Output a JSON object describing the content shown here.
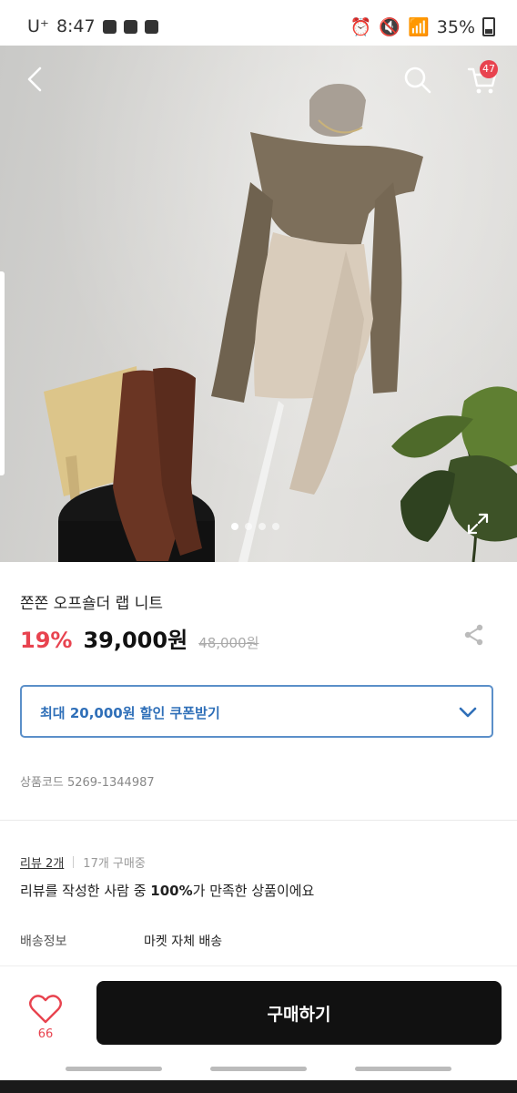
{
  "status_bar": {
    "carrier": "U⁺",
    "time": "8:47",
    "battery": "35%"
  },
  "header": {
    "back_icon": "chevron-left-icon",
    "search_icon": "search-icon",
    "cart_icon": "cart-icon",
    "cart_badge": "47"
  },
  "gallery": {
    "page_count": 4,
    "active_index": 0,
    "expand_icon": "expand-icon"
  },
  "product": {
    "title": "쫀쫀 오프숄더 랩 니트",
    "discount": "19%",
    "price": "39,000원",
    "original_price": "48,000원",
    "share_icon": "share-icon"
  },
  "coupon": {
    "label": "최대 20,000원 할인 쿠폰받기"
  },
  "product_code": "상품코드 5269-1344987",
  "reviews": {
    "link": "리뷰 2개",
    "purchases": "17개 구매중",
    "satisfaction_prefix": "리뷰를 작성한 사람 중 ",
    "satisfaction_percent": "100%",
    "satisfaction_suffix": "가 만족한 상품이에요"
  },
  "shipping": {
    "label": "배송정보",
    "value": "마켓 자체 배송"
  },
  "bottom_bar": {
    "like_count": "66",
    "buy_label": "구매하기"
  },
  "colors": {
    "accent_red": "#e8434f",
    "coupon_blue": "#2f6fb8",
    "buy_black": "#111111"
  }
}
